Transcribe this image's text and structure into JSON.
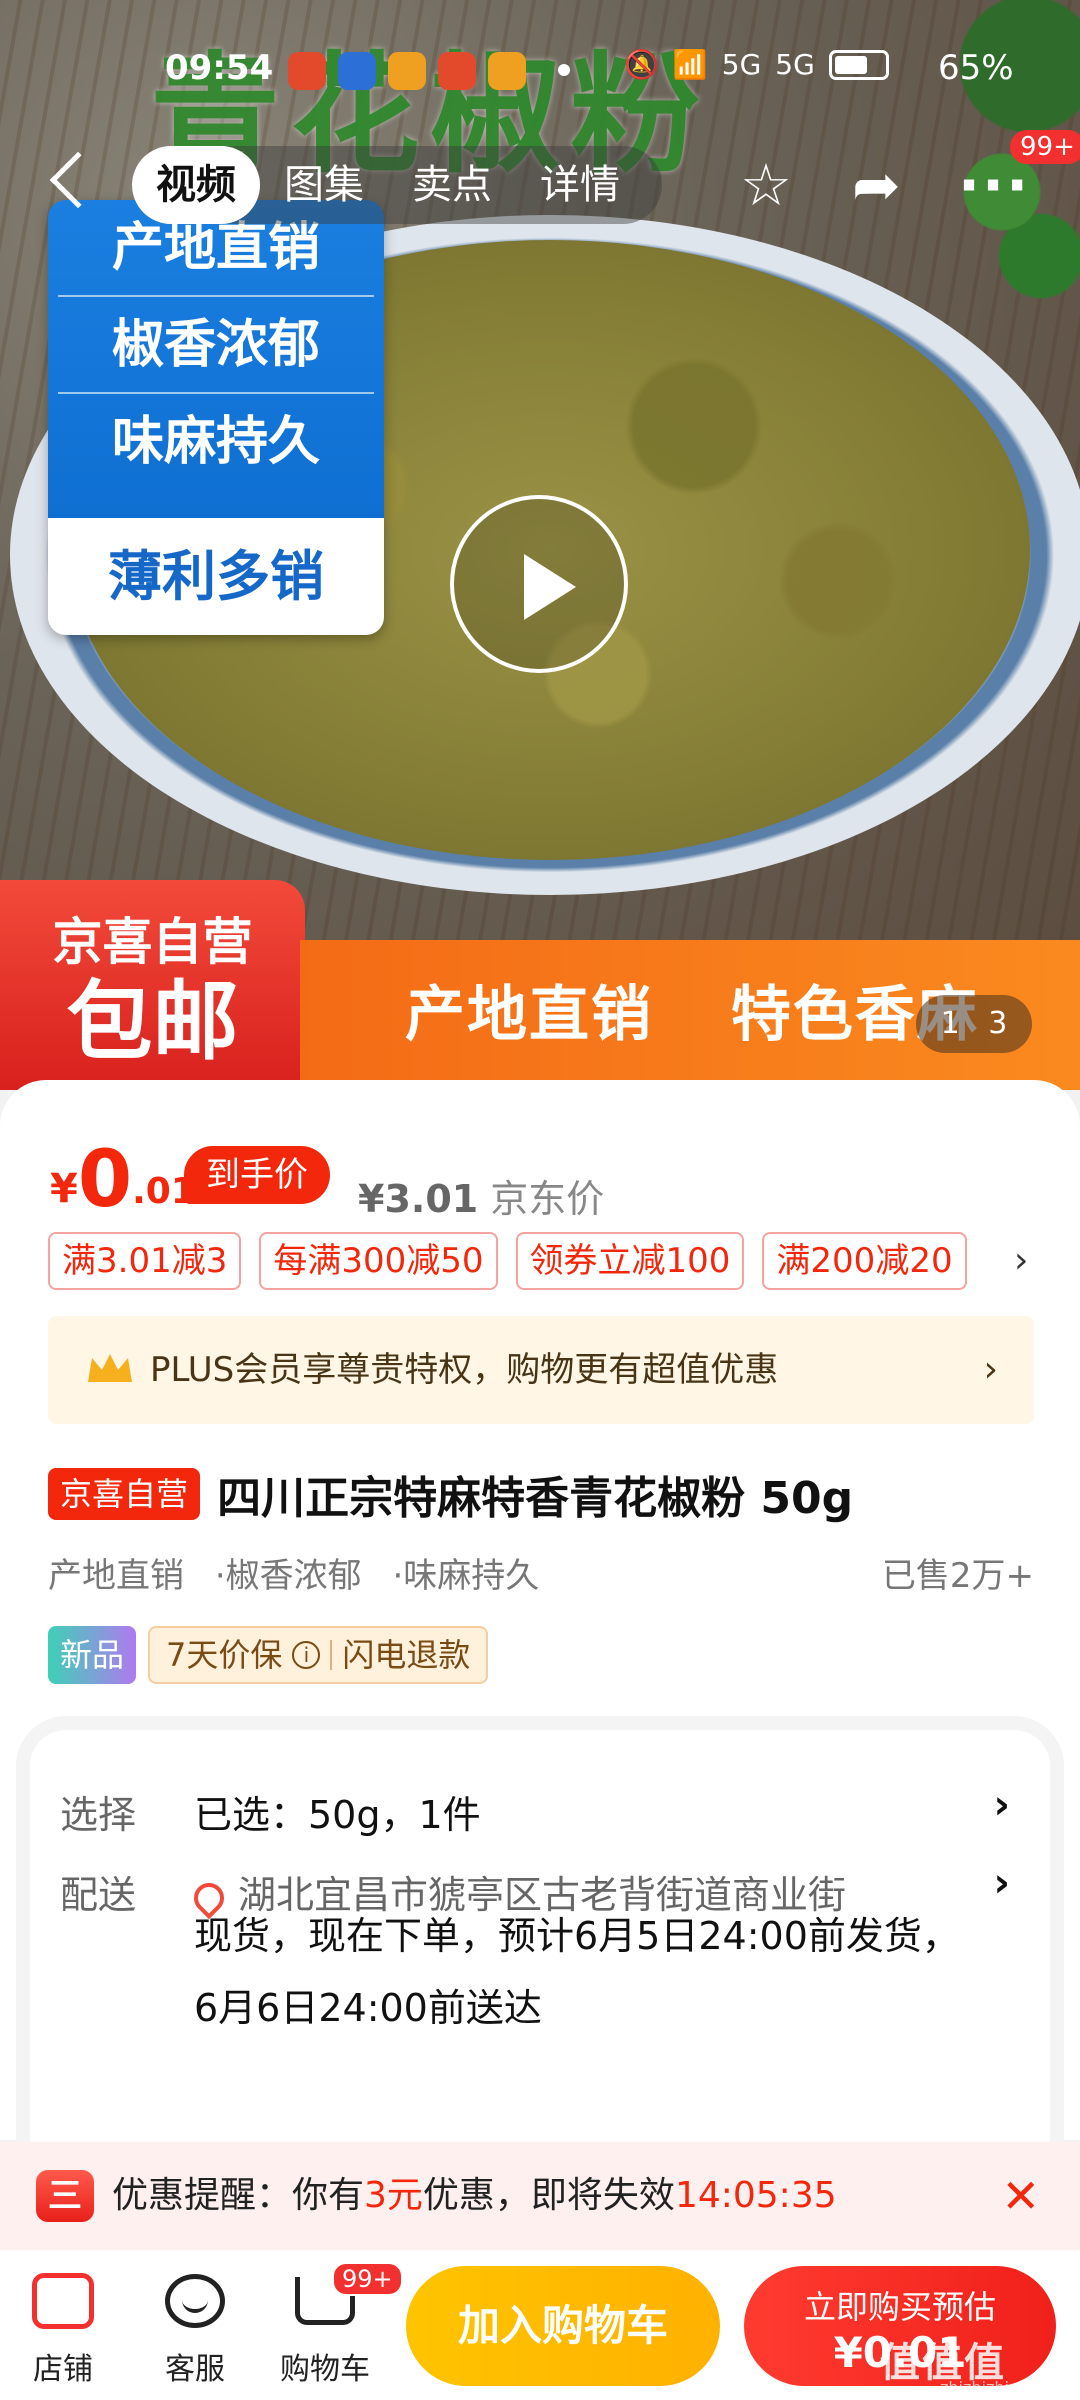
{
  "status_bar": {
    "time": "09:54",
    "signal": "5G",
    "battery": "65%"
  },
  "top_nav": {
    "tabs": [
      "视频",
      "图集",
      "卖点",
      "详情"
    ],
    "active_tab": "视频",
    "message_badge": "99+"
  },
  "hero": {
    "title_overlay": "青花椒粉",
    "features": [
      "产地直销",
      "椒香浓郁",
      "味麻持久",
      "薄利多销"
    ],
    "banner_left": [
      "京喜自营",
      "包邮"
    ],
    "banner_right": [
      "产地直销",
      "特色香麻"
    ],
    "counter": {
      "current": "1",
      "total": "3"
    }
  },
  "price": {
    "currency": "¥",
    "integer": "0",
    "decimal": ".01",
    "tag": "到手价",
    "jd_price": "¥3.01",
    "jd_price_label": "京东价"
  },
  "coupons": [
    "满3.01减3",
    "每满300减50",
    "领券立减100",
    "满200减20"
  ],
  "plus": {
    "text": "PLUS会员享尊贵特权，购物更有超值优惠"
  },
  "product": {
    "self_tag": "京喜自营",
    "title": "四川正宗特麻特香青花椒粉 50g",
    "tags": [
      "产地直销",
      "·椒香浓郁",
      "·味麻持久"
    ],
    "sold": "已售2万+",
    "badge_new": "新品",
    "guarantee": "7天价保",
    "refund": "闪电退款"
  },
  "options": {
    "select_label": "选择",
    "select_value": "已选：50g，1件",
    "delivery_label": "配送",
    "address": "湖北宜昌市猇亭区古老背街道商业街",
    "shipping": "现货，现在下单，预计6月5日24:00前发货，6月6日24:00前送达"
  },
  "reminder": {
    "icon": "三",
    "prefix": "优惠提醒：你有",
    "amount": "3元",
    "middle": "优惠，即将失效",
    "countdown": "14:05:35"
  },
  "bottom_bar": {
    "store": "店铺",
    "service": "客服",
    "cart": "购物车",
    "cart_badge": "99+",
    "add_to_cart": "加入购物车",
    "buy_now": "立即购买预估",
    "buy_price": "¥0.01"
  },
  "watermark": {
    "text": "值值值",
    "sub": "zhizhizhi.com"
  }
}
